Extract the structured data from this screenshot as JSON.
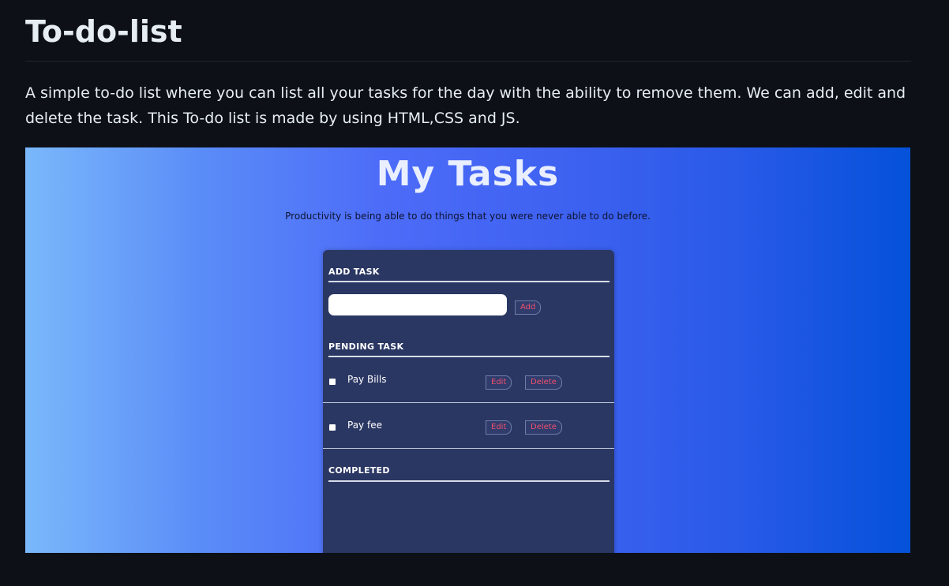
{
  "readme": {
    "title": "To-do-list",
    "description": "A simple to-do list where you can list all your tasks for the day with the ability to remove them. We can add, edit and delete the task. This To-do list is made by using HTML,CSS and JS."
  },
  "app": {
    "title": "My Tasks",
    "quote": "Productivity is being able to do things that you were never able to do before.",
    "add_section": {
      "heading": "ADD TASK",
      "input_value": "",
      "add_label": "Add"
    },
    "pending_section": {
      "heading": "PENDING TASK",
      "tasks": [
        {
          "label": "Pay Bills",
          "edit_label": "Edit",
          "delete_label": "Delete"
        },
        {
          "label": "Pay fee",
          "edit_label": "Edit",
          "delete_label": "Delete"
        }
      ]
    },
    "completed_section": {
      "heading": "COMPLETED"
    }
  },
  "colors": {
    "page_background": "#0d1117",
    "card_background": "#2b3763",
    "button_text": "#f0506e",
    "gradient_left": "#7ab8fb",
    "gradient_right": "#0451da"
  }
}
